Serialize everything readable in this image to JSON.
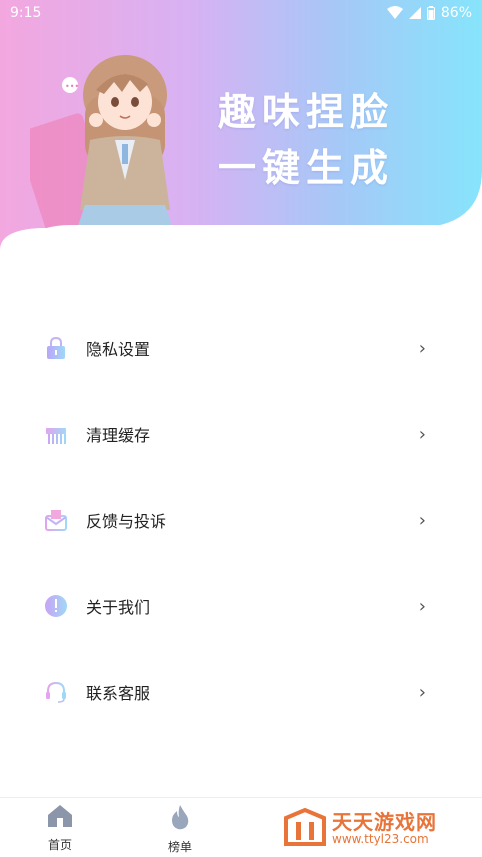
{
  "status_bar": {
    "time": "9:15",
    "battery": "86%",
    "icons": [
      "wifi-icon",
      "signal-icon",
      "battery-icon"
    ]
  },
  "hero": {
    "title_line1": "趣味捏脸",
    "title_line2": "一键生成",
    "colors": {
      "left": "#f3a7df",
      "mid": "#d7b2f3",
      "right": "#86e4fb"
    }
  },
  "menu": {
    "items": [
      {
        "label": "隐私设置",
        "icon": "lock-icon"
      },
      {
        "label": "清理缓存",
        "icon": "brush-icon"
      },
      {
        "label": "反馈与投诉",
        "icon": "mail-icon"
      },
      {
        "label": "关于我们",
        "icon": "info-icon"
      },
      {
        "label": "联系客服",
        "icon": "headset-icon"
      }
    ],
    "chevron": "›"
  },
  "tabbar": {
    "tabs": [
      {
        "label": "首页",
        "icon": "home-icon"
      },
      {
        "label": "榜单",
        "icon": "flame-icon"
      }
    ]
  },
  "watermark": {
    "name": "天天游戏网",
    "url": "www.ttyl23.com"
  }
}
